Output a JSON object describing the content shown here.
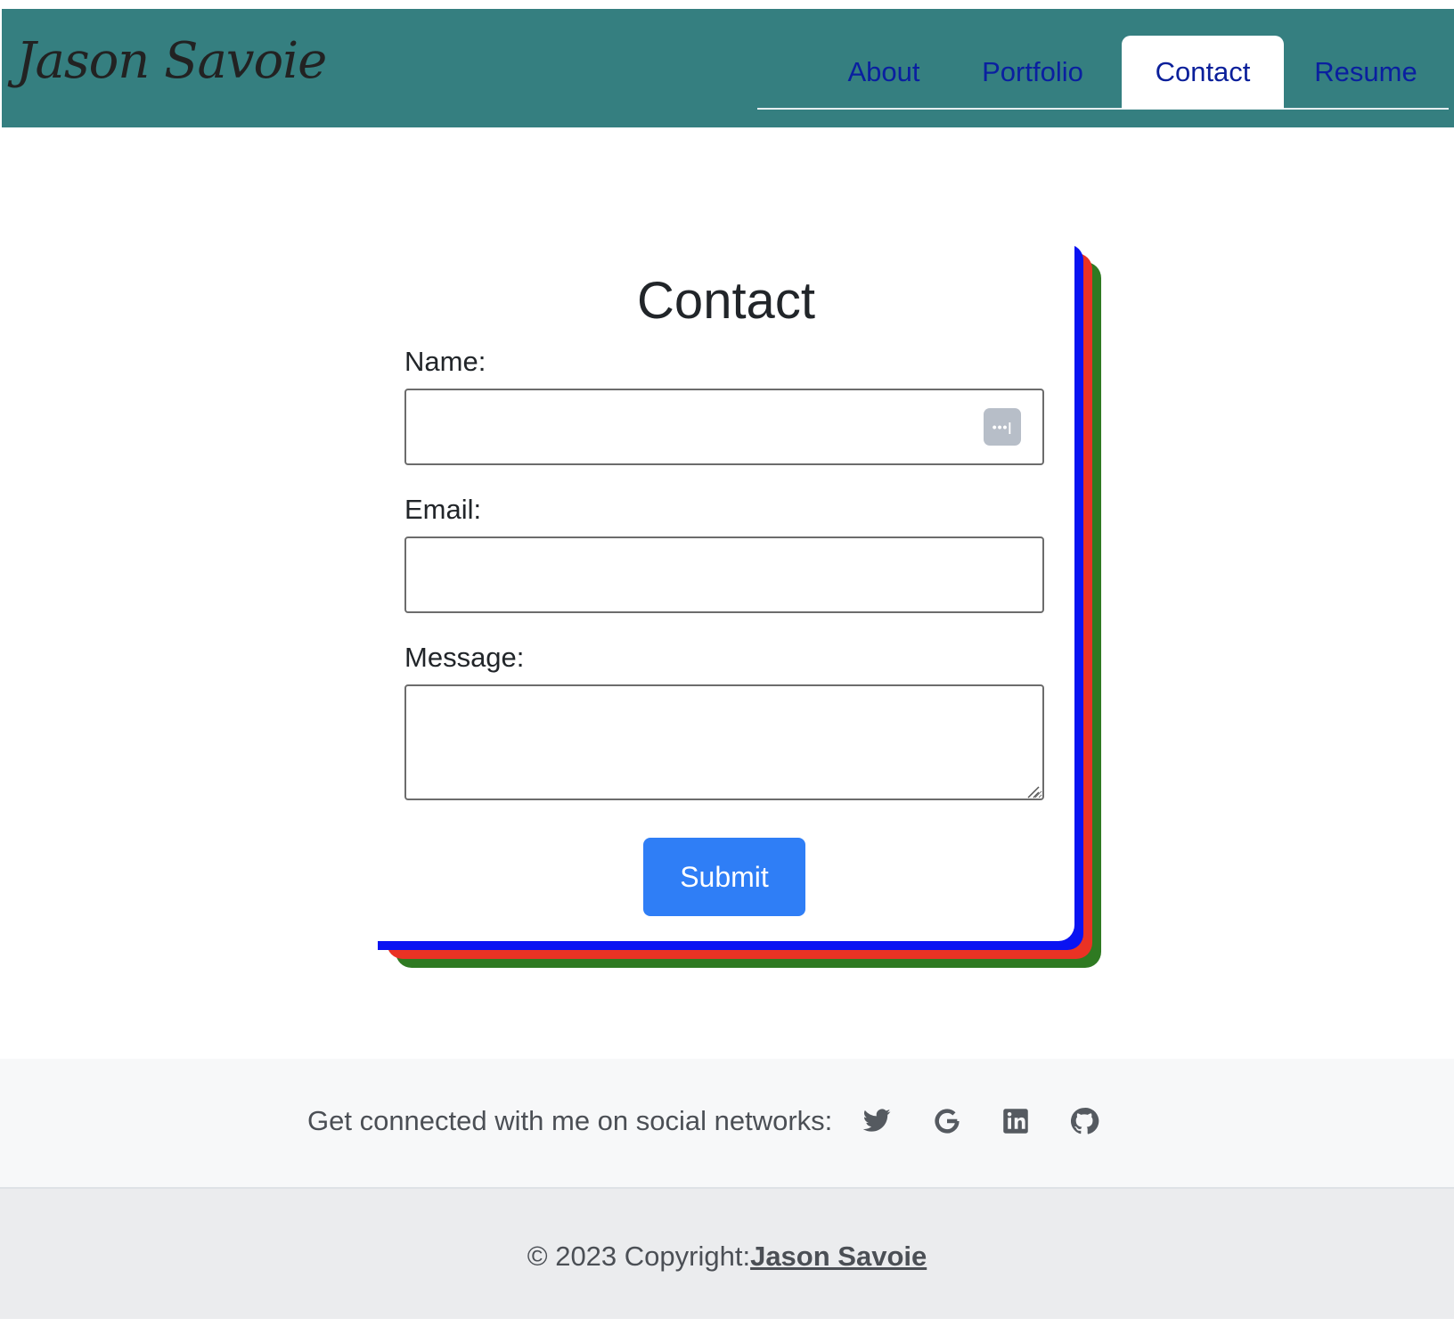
{
  "header": {
    "brand": "Jason Savoie",
    "nav": [
      {
        "label": "About",
        "active": false
      },
      {
        "label": "Portfolio",
        "active": false
      },
      {
        "label": "Contact",
        "active": true
      },
      {
        "label": "Resume",
        "active": false
      }
    ]
  },
  "form": {
    "title": "Contact",
    "name_label": "Name:",
    "email_label": "Email:",
    "message_label": "Message:",
    "name_value": "",
    "email_value": "",
    "message_value": "",
    "submit_label": "Submit",
    "password_manager_icon": "key-dots-icon"
  },
  "colors": {
    "header_bg": "#357f80",
    "nav_text": "#0a1fa0",
    "card_shadow_blue": "#0a13f2",
    "card_shadow_red": "#ea3224",
    "card_shadow_green": "#2f7a22",
    "submit_bg": "#2f7ef6"
  },
  "social": {
    "text": "Get connected with me on social networks:",
    "icons": [
      "twitter-icon",
      "google-icon",
      "linkedin-icon",
      "github-icon"
    ]
  },
  "copyright": {
    "text": "© 2023 Copyright:",
    "link_text": "Jason Savoie"
  }
}
